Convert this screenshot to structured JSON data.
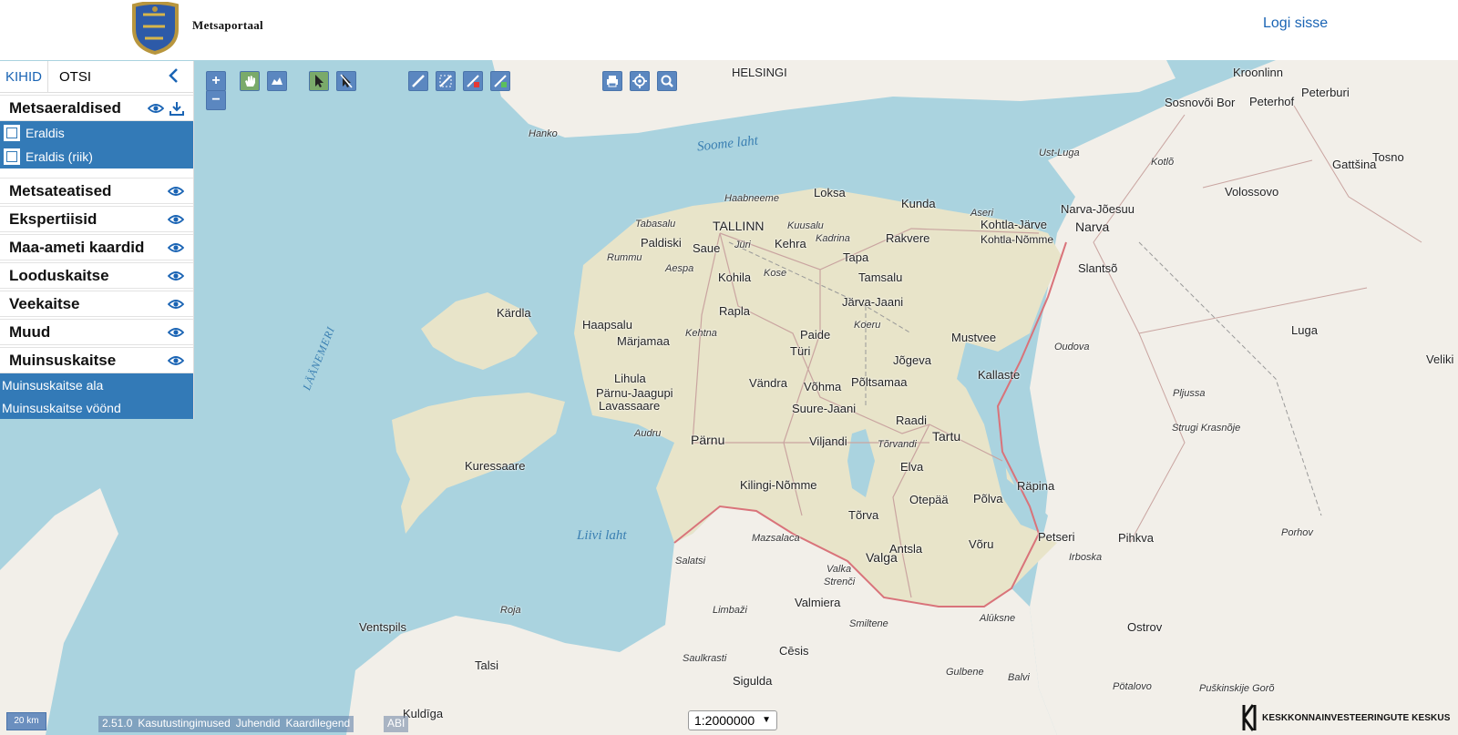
{
  "header": {
    "brand": "Metsaportaal",
    "login_label": "Logi sisse"
  },
  "sidebar": {
    "tabs": [
      {
        "label": "KIHID",
        "active": true
      },
      {
        "label": "OTSI",
        "active": false
      }
    ],
    "collapse_icon": "chevron-left-icon",
    "groups": [
      {
        "label": "Metsaeraldised",
        "icons": [
          "eye-icon",
          "download-icon"
        ],
        "items": [
          "Eraldis",
          "Eraldis (riik)"
        ]
      },
      {
        "label": "Metsateatised",
        "icons": [
          "eye-icon"
        ]
      },
      {
        "label": "Ekspertiisid",
        "icons": [
          "eye-icon"
        ]
      },
      {
        "label": "Maa-ameti kaardid",
        "icons": [
          "eye-icon"
        ]
      },
      {
        "label": "Looduskaitse",
        "icons": [
          "eye-icon"
        ]
      },
      {
        "label": "Veekaitse",
        "icons": [
          "eye-icon"
        ]
      },
      {
        "label": "Muud",
        "icons": [
          "eye-icon"
        ]
      },
      {
        "label": "Muinsuskaitse",
        "icons": [
          "eye-icon"
        ],
        "items": [
          "Muinsuskaitse ala",
          "Muinsuskaitse vöönd"
        ]
      }
    ]
  },
  "toolbar": {
    "zoom_in": "+",
    "zoom_out": "−",
    "tools": [
      "pan-hand-icon",
      "full-extent-icon",
      "select-icon",
      "deselect-icon",
      "measure-line-icon",
      "measure-area-icon",
      "erase-measure-icon",
      "draw-polygon-icon",
      "print-icon",
      "locate-icon",
      "search-zoom-icon"
    ]
  },
  "map": {
    "labels": {
      "helsingi": "HELSINGI",
      "hanko": "Hanko",
      "kroonlinn": "Kroonlinn",
      "peterburi": "Peterburi",
      "sosnovoi": "Sosnovõi Bor",
      "peterhof": "Peterhof",
      "soome_laht": "Soome laht",
      "ust_luga": "Ust-Luga",
      "kotlo": "Kotlõ",
      "gattsina": "Gattšina",
      "tosno": "Tosno",
      "volossovo": "Volossovo",
      "haabneeme": "Haabneeme",
      "loksa": "Loksa",
      "kunda": "Kunda",
      "aseri": "Aseri",
      "kohtla_jarve": "Kohtla-Järve",
      "narva_joesuu": "Narva-Jõesuu",
      "narva": "Narva",
      "kohtla_nomme": "Kohtla-Nõmme",
      "tabasalu": "Tabasalu",
      "tallinn": "TALLINN",
      "kuusalu": "Kuusalu",
      "paldiski": "Paldiski",
      "saue": "Saue",
      "juri": "Jüri",
      "kehra": "Kehra",
      "kadrina": "Kadrina",
      "rakvere": "Rakvere",
      "rummu": "Rummu",
      "aespa": "Aespa",
      "tapa": "Tapa",
      "kose": "Kose",
      "kohila": "Kohila",
      "tamsalu": "Tamsalu",
      "slantso": "Slantsõ",
      "kardla": "Kärdla",
      "rapla": "Rapla",
      "jarva_jaani": "Järva-Jaani",
      "haapsalu": "Haapsalu",
      "koeru": "Koeru",
      "kehtna": "Kehtna",
      "marjamaa": "Märjamaa",
      "paide": "Paide",
      "mustvee": "Mustvee",
      "oudova": "Oudova",
      "luga": "Luga",
      "laanemeri": "LÄÄNEMERI",
      "turi": "Türi",
      "jogeva": "Jõgeva",
      "lihula": "Lihula",
      "kallaste": "Kallaste",
      "vandra": "Vändra",
      "vohma": "Võhma",
      "poltsamaa": "Põltsamaa",
      "veliki": "Veliki",
      "parnu_jaagupi": "Pärnu-Jaagupi",
      "lavassaare": "Lavassaare",
      "pljussa": "Pljussa",
      "suure_jaani": "Suure-Jaani",
      "raadi": "Raadi",
      "audru": "Audru",
      "tartu": "Tartu",
      "strugi": "Strugi Krasnõje",
      "parnu": "Pärnu",
      "viljandi": "Viljandi",
      "torvandi": "Tõrvandi",
      "kuressaare": "Kuressaare",
      "elva": "Elva",
      "kilingi": "Kilingi-Nõmme",
      "rapina": "Räpina",
      "otepaa": "Otepää",
      "polva": "Põlva",
      "torva": "Tõrva",
      "liivi_laht": "Liivi laht",
      "mazsalaca": "Mazsalaca",
      "petseri": "Petseri",
      "pihkva": "Pihkva",
      "porhov": "Porhov",
      "valga": "Valga",
      "antsla": "Antsla",
      "voru": "Võru",
      "salatsi": "Salatsi",
      "irboska": "Irboska",
      "valka": "Valka",
      "strenci": "Strenči",
      "limbazi": "Limbaži",
      "valmiera": "Valmiera",
      "roja": "Roja",
      "aluksne": "Alūksne",
      "ventspils": "Ventspils",
      "smiltene": "Smiltene",
      "ostrov": "Ostrov",
      "saulkrasti": "Saulkrasti",
      "cesis": "Cēsis",
      "talsi": "Talsi",
      "gulbene": "Gulbene",
      "balvi": "Balvi",
      "sigulda": "Sigulda",
      "potalovo": "Pötalovo",
      "puskinskije": "Puškinskije Gorõ",
      "kuldiga": "Kuldīga"
    }
  },
  "footer": {
    "scalebar": "20 km",
    "version": "2.51.0",
    "links": [
      "Kasutustingimused",
      "Juhendid",
      "Kaardilegend"
    ],
    "abi": "ABI",
    "scale_value": "1:2000000",
    "org": "KESKKONNAINVESTEERINGUTE KESKUS"
  }
}
